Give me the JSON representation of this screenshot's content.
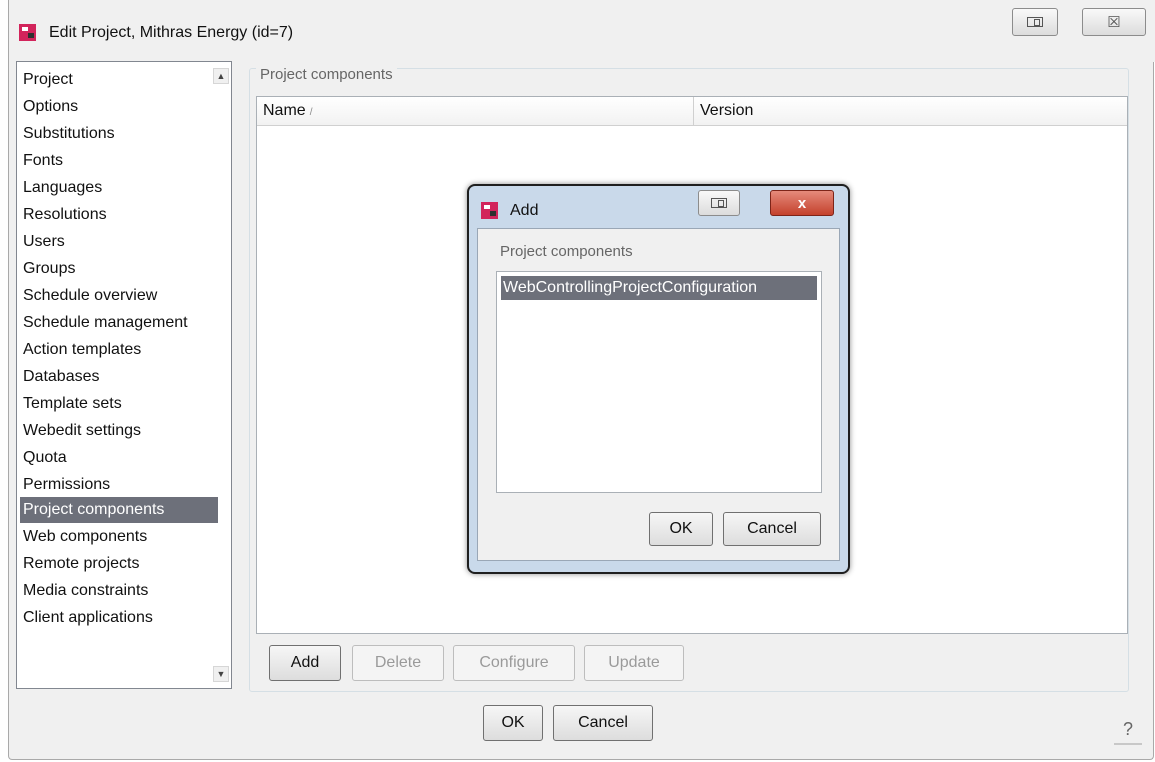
{
  "window": {
    "title": "Edit Project, Mithras Energy (id=7)",
    "close_glyph": "☒"
  },
  "nav": {
    "items": [
      {
        "label": "Project"
      },
      {
        "label": "Options"
      },
      {
        "label": "Substitutions"
      },
      {
        "label": "Fonts"
      },
      {
        "label": "Languages"
      },
      {
        "label": "Resolutions"
      },
      {
        "label": "Users"
      },
      {
        "label": "Groups"
      },
      {
        "label": "Schedule overview"
      },
      {
        "label": "Schedule management"
      },
      {
        "label": "Action templates"
      },
      {
        "label": "Databases"
      },
      {
        "label": "Template sets"
      },
      {
        "label": "Webedit settings"
      },
      {
        "label": "Quota"
      },
      {
        "label": "Permissions"
      },
      {
        "label": "Project components",
        "selected": true
      },
      {
        "label": "Web components"
      },
      {
        "label": "Remote projects"
      },
      {
        "label": "Media constraints"
      },
      {
        "label": "Client applications"
      }
    ]
  },
  "panel": {
    "group_title": "Project components",
    "columns": [
      "Name",
      "Version"
    ],
    "buttons": {
      "add": "Add",
      "delete": "Delete",
      "configure": "Configure",
      "update": "Update"
    }
  },
  "footer": {
    "ok": "OK",
    "cancel": "Cancel",
    "help": "?"
  },
  "dialog": {
    "title": "Add",
    "close_label": "x",
    "list_label": "Project components",
    "items": [
      "WebControllingProjectConfiguration"
    ],
    "ok": "OK",
    "cancel": "Cancel"
  },
  "colors": {
    "selection": "#6d707a",
    "brand_icon": "#d2245b",
    "close_button": "#c4412c"
  },
  "icons": [
    "app-logo-icon",
    "restore-icon",
    "close-icon",
    "scroll-up-icon",
    "scroll-down-icon",
    "sort-icon",
    "help-icon"
  ]
}
